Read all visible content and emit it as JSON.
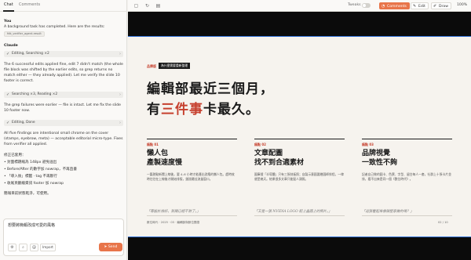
{
  "tabs": [
    "Chat",
    "Comments"
  ],
  "chat": {
    "you_label": "You",
    "you_text": "A background task has completed. Here are the results:",
    "result_chip": "fdk_verifier_agent-result",
    "claude_label": "Claude",
    "status1": "Editing, Searching ×2",
    "para1": "The 6 successful edits applied fine, edit 7 didn't match (the whole file block was shifted by the earlier edits, so grep returns no match either — they already applied). Let me verify the slide 10 footer is correct.",
    "status2": "Searching ×3, Reading ×2",
    "para2": "The grep failures were earlier — file is intact. Let me fix the slide 10 footer now.",
    "status3": "Editing, Done",
    "para3": "All five findings are intentional small chrome on the cover (stamps, eyebrow, meta) — acceptable editorial micro-type. Fixes from verifier all applied.",
    "fixes_heading": "修正已套用：",
    "fixes": [
      "封面標題縮為 148px 避免溢出",
      "Before/After 的數字加 nowrap，不再直書",
      "「導入後」標籤 · tag 不再斷行",
      "收尾頁翻繪資訊 footer 加 nowrap"
    ],
    "closing": "簡報目前狀態乾淨，可使用。"
  },
  "composer": {
    "value": "想要將簡報改成可愛的風格",
    "import_label": "Import",
    "send_label": "Send"
  },
  "toolbar": {
    "tweaks_label": "Tweaks",
    "comments_label": "Comments",
    "edit_label": "Edit",
    "draw_label": "Draw",
    "zoom": "100%"
  },
  "slide": {
    "tag": "品牌版",
    "tag_dark": "為什麼需要重新整理",
    "headline_line1": "編輯部最近三個月，",
    "headline_line2_a": "有",
    "headline_line2_red": "三件事",
    "headline_line2_b": "卡最久。",
    "columns": [
      {
        "label": "痛點 01",
        "title": "懶人包\n產製速度慢",
        "body": "一篇熱點新聞上線後，要 4–6 小時才能產出對應的懶人包。趕時效時往往在上線後才開始排版，錯過最佳流量窗口。",
        "quote": "「等設計排好，新聞已經不熱了。」"
      },
      {
        "label": "痛點 02",
        "title": "文章配圖\n找不到合適素材",
        "body": "圖庫搜「半導體」只有三張刻板照；自製示意圖要繪圖師排程，一律就是幾天。結果很多文章只能配人頭照。",
        "quote": "「又是一張 NVIDIA LOGO 配上晶圓上的照片。」"
      },
      {
        "label": "痛點 03",
        "title": "品牌視覺\n一致性不夠",
        "body": "記者自己做的圖卡、色票、字型、留白每人一套，社群上十張卡片並排，看不出來是同一個《數位時代》。",
        "quote": "「這張看起來像隔壁家做的嗎？」"
      }
    ],
    "footer_left": "數位時代 · 2025 · 03 · 編輯部與數位閱讀",
    "footer_right": "02 / 10"
  },
  "colors": {
    "accent": "#e8754a",
    "slide_red": "#c6402e",
    "slide_bg": "#f6f3ee",
    "stage_bg": "#0b0b0b"
  }
}
